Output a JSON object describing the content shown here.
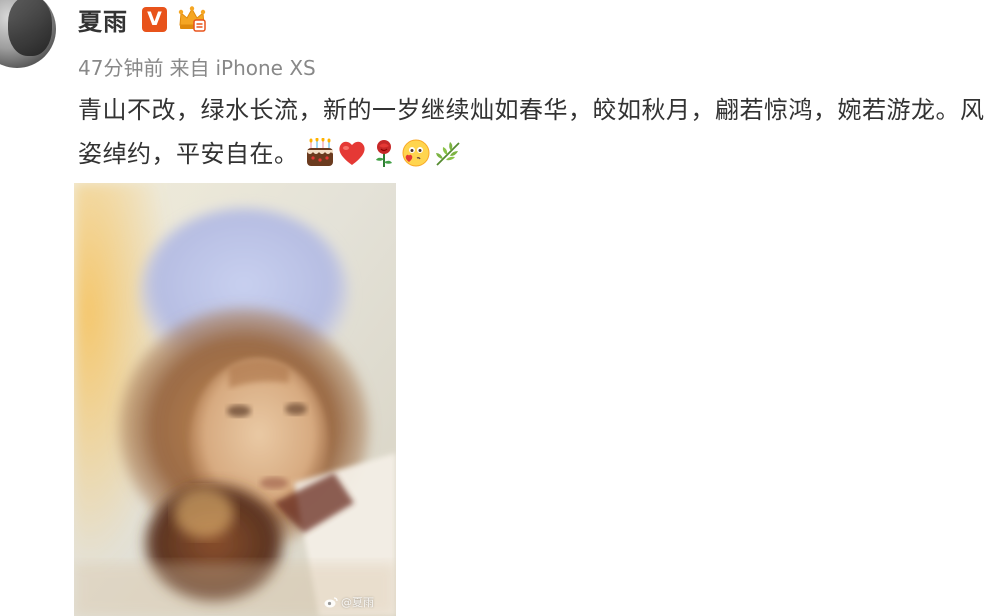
{
  "user": {
    "name": "夏雨",
    "verified_badge": "V",
    "avatar_icon": "avatar-icon",
    "crown_icon": "crown-icon"
  },
  "post": {
    "time": "47分钟前",
    "source_prefix": "来自",
    "source": "iPhone XS",
    "text": "青山不改，绿水长流，新的一岁继续灿如春华，皎如秋月，翩若惊鸿，婉若游龙。风姿绰约，平安自在。",
    "emojis": [
      "cake-icon",
      "heart-icon",
      "rose-icon",
      "kiss-face-icon",
      "leaf-icon"
    ],
    "image": {
      "watermark": "@夏雨"
    }
  },
  "colors": {
    "vip_badge": "#e8531b",
    "crown": "#f5a623",
    "text": "#333333",
    "meta": "#888888"
  }
}
